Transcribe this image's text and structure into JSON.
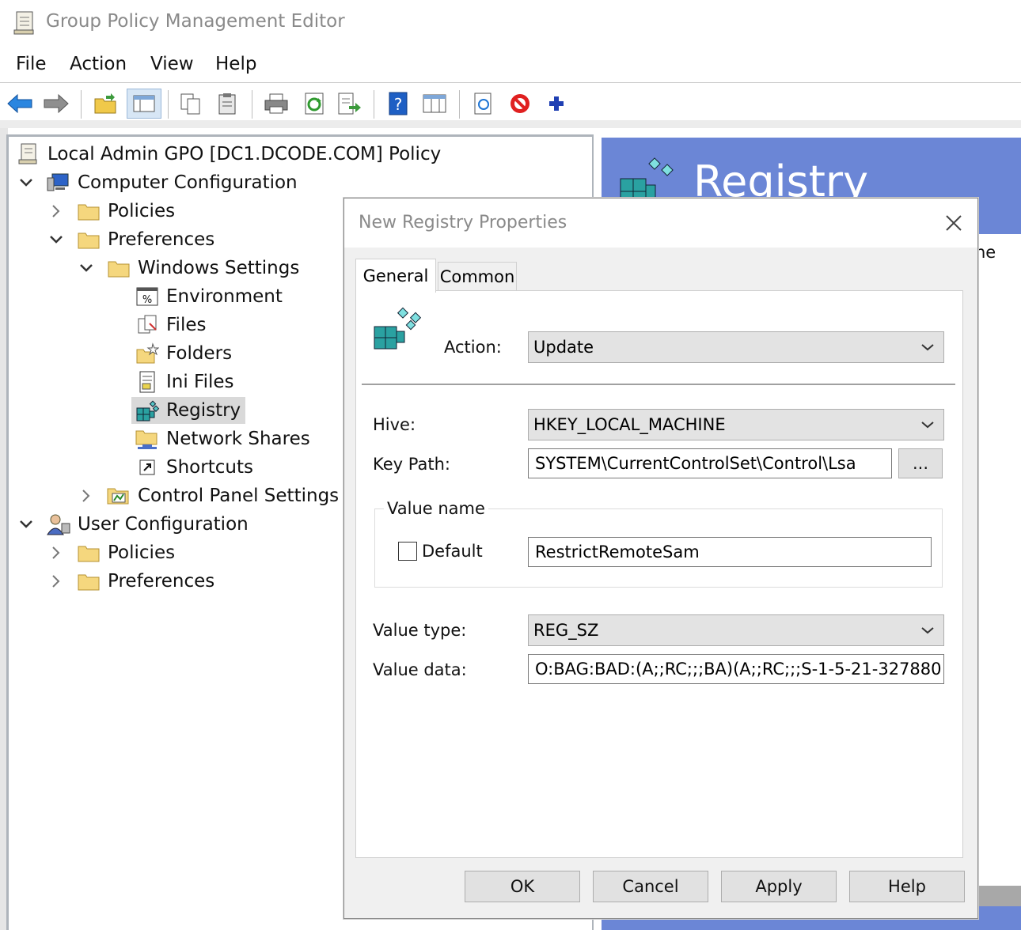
{
  "window": {
    "title": "Group Policy Management Editor"
  },
  "menu": [
    "File",
    "Action",
    "View",
    "Help"
  ],
  "toolbar": [
    "back-icon",
    "forward-icon",
    "up-folder-icon",
    "show-hide-tree-icon",
    "copy-icon",
    "paste-icon",
    "print-icon",
    "refresh-icon",
    "export-icon",
    "help-icon",
    "properties-pane-icon",
    "new-item-icon",
    "stop-icon",
    "add-icon"
  ],
  "tree": {
    "root": "Local Admin GPO [DC1.DCODE.COM] Policy",
    "computer_configuration": "Computer Configuration",
    "policies": "Policies",
    "preferences": "Preferences",
    "windows_settings": "Windows Settings",
    "environment": "Environment",
    "files": "Files",
    "folders": "Folders",
    "ini_files": "Ini Files",
    "registry": "Registry",
    "network_shares": "Network Shares",
    "shortcuts": "Shortcuts",
    "control_panel_settings": "Control Panel Settings",
    "user_configuration": "User Configuration",
    "user_policies": "Policies",
    "user_preferences": "Preferences"
  },
  "right_pane": {
    "banner_title": "Registry",
    "fragment": "ne"
  },
  "dialog": {
    "title": "New Registry Properties",
    "tabs": [
      "General",
      "Common"
    ],
    "action_label": "Action:",
    "action_value": "Update",
    "hive_label": "Hive:",
    "hive_value": "HKEY_LOCAL_MACHINE",
    "key_path_label": "Key Path:",
    "key_path_value": "SYSTEM\\CurrentControlSet\\Control\\Lsa",
    "browse_label": "...",
    "value_name_group": "Value name",
    "default_label": "Default",
    "default_checked": false,
    "value_name": "RestrictRemoteSam",
    "value_type_label": "Value type:",
    "value_type": "REG_SZ",
    "value_data_label": "Value data:",
    "value_data": "O:BAG:BAD:(A;;RC;;;BA)(A;;RC;;;S-1-5-21-327880",
    "buttons": {
      "ok": "OK",
      "cancel": "Cancel",
      "apply": "Apply",
      "help": "Help"
    }
  },
  "colors": {
    "banner": "#6b86d6",
    "accent_blue": "#1e74d4",
    "stop_red": "#e02020"
  }
}
